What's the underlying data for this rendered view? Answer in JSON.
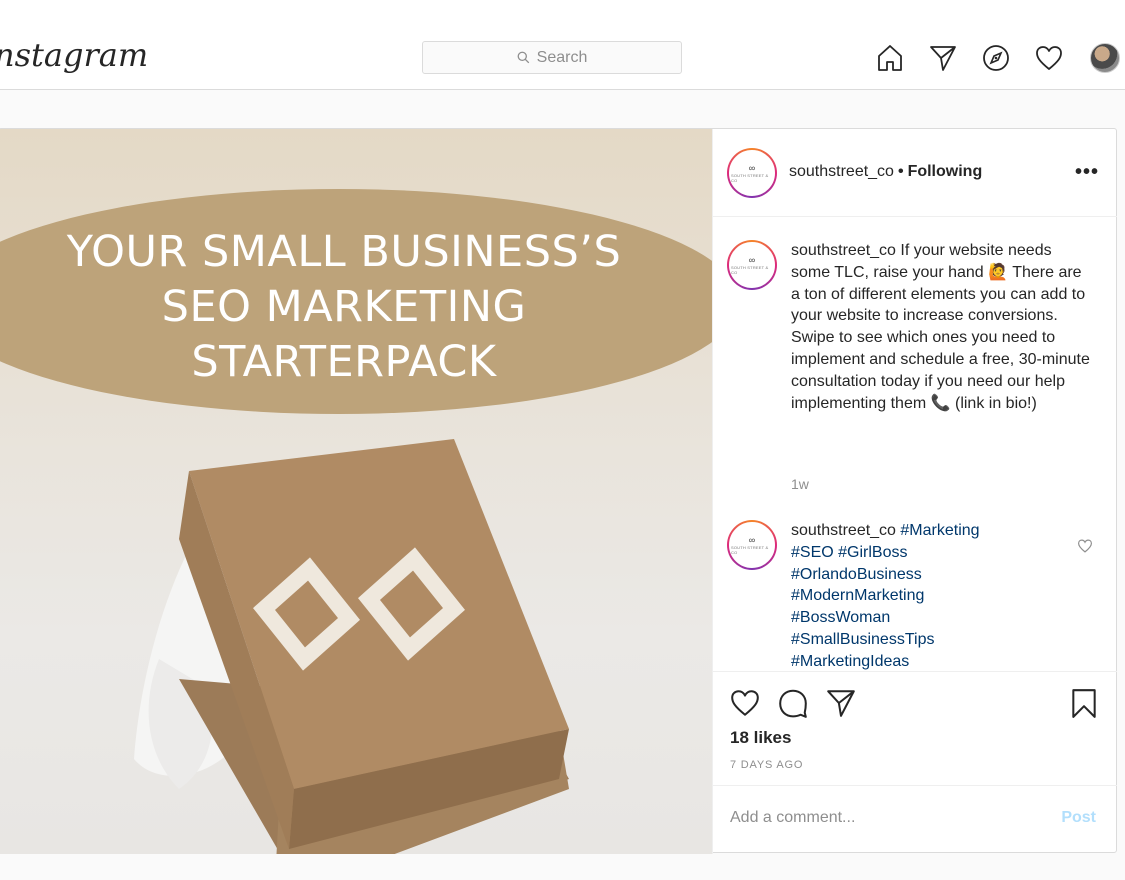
{
  "nav": {
    "logo": "nstagram",
    "search_placeholder": "Search",
    "icons": [
      "home-icon",
      "direct-icon",
      "explore-icon",
      "activity-icon",
      "profile-avatar"
    ]
  },
  "post": {
    "headline": [
      "YOUR SMALL BUSINESS’S",
      "SEO MARKETING",
      "STARTERPACK"
    ],
    "username": "southstreet_co",
    "separator": "•",
    "following": "Following",
    "more": "•••",
    "caption": {
      "username": "southstreet_co",
      "text": " If your website needs some TLC, raise your hand 🙋 There are a ton of different elements you can add to your website to increase conversions. Swipe to see which ones you need to implement and schedule a free, 30-minute consultation today if you need our help implementing them 📞 (link in bio!)",
      "time": "1w"
    },
    "comment": {
      "username": "southstreet_co",
      "tags": [
        "#Marketing",
        "#SEO",
        "#GirlBoss",
        "#OrlandoBusiness",
        "#ModernMarketing",
        "#BossWoman",
        "#SmallBusinessTips",
        "#MarketingIdeas"
      ]
    },
    "likes": "18 likes",
    "posted": "7 DAYS AGO",
    "comment_placeholder": "Add a comment...",
    "post_label": "Post"
  },
  "colors": {
    "banner": "#bda37a",
    "link": "#00376b",
    "post_disabled": "#b2dffc"
  }
}
